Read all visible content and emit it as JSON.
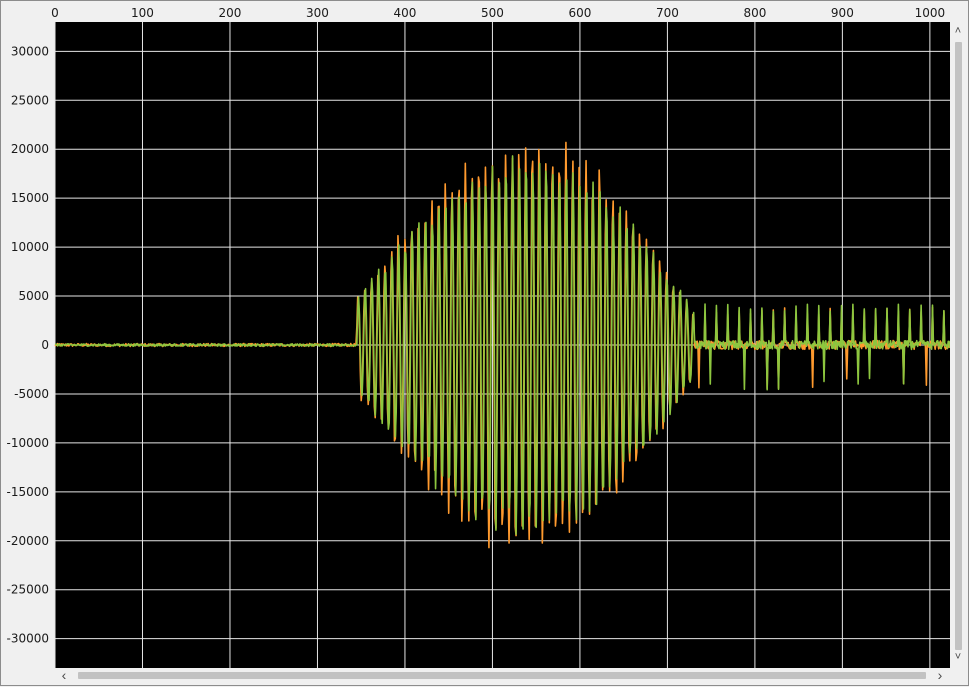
{
  "chart_data": {
    "type": "line",
    "title": "",
    "xlabel": "",
    "ylabel": "",
    "xlim": [
      0,
      1023
    ],
    "ylim": [
      -33000,
      33000
    ],
    "x_ticks": [
      "0",
      "100",
      "200",
      "300",
      "400",
      "500",
      "600",
      "700",
      "800",
      "900",
      "1000"
    ],
    "y_ticks": [
      "30000",
      "25000",
      "20000",
      "15000",
      "10000",
      "5000",
      "0",
      "-5000",
      "-10000",
      "-15000",
      "-20000",
      "-25000",
      "-30000"
    ],
    "x_tick_values": [
      0,
      100,
      200,
      300,
      400,
      500,
      600,
      700,
      800,
      900,
      1000
    ],
    "y_tick_values": [
      30000,
      25000,
      20000,
      15000,
      10000,
      5000,
      0,
      -5000,
      -10000,
      -15000,
      -20000,
      -25000,
      -30000
    ],
    "grid": true,
    "background": "#000000",
    "series": [
      {
        "color": "#ff9a2e",
        "n_samples": 1024,
        "onset_x": 345,
        "peak_x": 545,
        "decay_x": 730,
        "peak_amplitude": 21500,
        "tail_amplitude": 3500,
        "noise_amplitude": 150
      },
      {
        "color": "#8dc63f",
        "n_samples": 1024,
        "onset_x": 345,
        "peak_x": 545,
        "decay_x": 730,
        "peak_amplitude": 20000,
        "tail_amplitude": 3800,
        "noise_amplitude": 120
      }
    ]
  },
  "scrollbars": {
    "up_arrow": "˄",
    "down_arrow": "˅",
    "left_arrow": "‹",
    "right_arrow": "›"
  }
}
